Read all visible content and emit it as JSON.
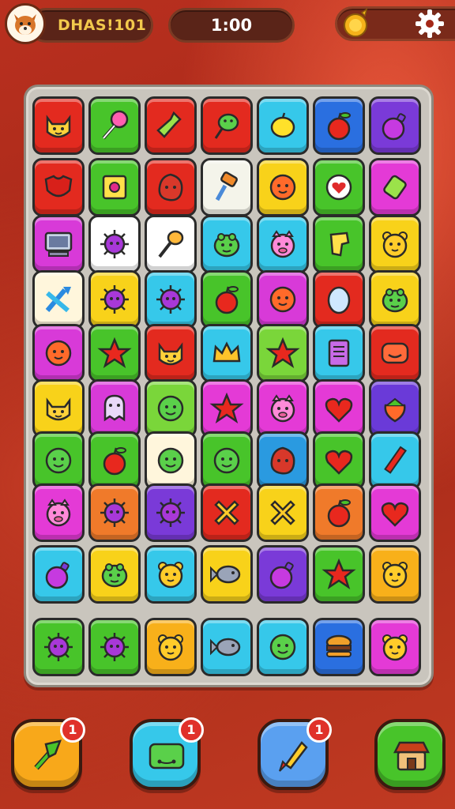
{
  "header": {
    "player_name": "DHAS!101",
    "timer": "1:00",
    "avatar_icon": "fox-avatar-icon",
    "coin_icon": "coin-icon",
    "settings_icon": "gear-icon"
  },
  "board": {
    "columns": 7,
    "rows": 10,
    "tiles": [
      [
        {
          "c": "#e32a1f",
          "i": "cat-face"
        },
        {
          "c": "#48c42a",
          "i": "lollipop"
        },
        {
          "c": "#e32a1f",
          "i": "bottle"
        },
        {
          "c": "#e32a1f",
          "i": "leaf"
        },
        {
          "c": "#36c8ea",
          "i": "lemon"
        },
        {
          "c": "#2a6fe0",
          "i": "apple"
        },
        {
          "c": "#7a3ad8",
          "i": "bomb"
        }
      ],
      [
        {
          "c": "#e32a1f",
          "i": "shirt"
        },
        {
          "c": "#48c42a",
          "i": "safe"
        },
        {
          "c": "#e32a1f",
          "i": "blob"
        },
        {
          "c": "#f4f4ea",
          "i": "hammer"
        },
        {
          "c": "#f8d21a",
          "i": "ball"
        },
        {
          "c": "#48c42a",
          "i": "heart-disc"
        },
        {
          "c": "#e43ad6",
          "i": "candy"
        }
      ],
      [
        {
          "c": "#d83ad8",
          "i": "computer"
        },
        {
          "c": "#ffffff",
          "i": "virus"
        },
        {
          "c": "#ffffff",
          "i": "ladle"
        },
        {
          "c": "#36c8ea",
          "i": "frog"
        },
        {
          "c": "#36c8ea",
          "i": "pig"
        },
        {
          "c": "#48c42a",
          "i": "block"
        },
        {
          "c": "#f8d21a",
          "i": "bear"
        }
      ],
      [
        {
          "c": "#fff6dc",
          "i": "arrows"
        },
        {
          "c": "#f8d21a",
          "i": "virus"
        },
        {
          "c": "#36c8ea",
          "i": "virus"
        },
        {
          "c": "#48c42a",
          "i": "apple"
        },
        {
          "c": "#d83ad8",
          "i": "ball"
        },
        {
          "c": "#e32a1f",
          "i": "egg"
        },
        {
          "c": "#f8d21a",
          "i": "frog"
        }
      ],
      [
        {
          "c": "#d83ad8",
          "i": "ball"
        },
        {
          "c": "#48c42a",
          "i": "star"
        },
        {
          "c": "#e32a1f",
          "i": "cat-face"
        },
        {
          "c": "#36c8ea",
          "i": "crown"
        },
        {
          "c": "#7ad63a",
          "i": "star"
        },
        {
          "c": "#36c8ea",
          "i": "note"
        },
        {
          "c": "#e32a1f",
          "i": "mask"
        }
      ],
      [
        {
          "c": "#f8d21a",
          "i": "cat-face"
        },
        {
          "c": "#d83ad8",
          "i": "ghost"
        },
        {
          "c": "#7ad63a",
          "i": "face"
        },
        {
          "c": "#e43ad6",
          "i": "star"
        },
        {
          "c": "#e43ad6",
          "i": "pig"
        },
        {
          "c": "#e43ad6",
          "i": "heart"
        },
        {
          "c": "#6a3ad8",
          "i": "strawberry"
        }
      ],
      [
        {
          "c": "#48c42a",
          "i": "face"
        },
        {
          "c": "#48c42a",
          "i": "apple"
        },
        {
          "c": "#fff6dc",
          "i": "face"
        },
        {
          "c": "#48c42a",
          "i": "face"
        },
        {
          "c": "#2a9ae0",
          "i": "blob"
        },
        {
          "c": "#48c42a",
          "i": "heart"
        },
        {
          "c": "#36c8ea",
          "i": "pencil"
        }
      ],
      [
        {
          "c": "#e43ad6",
          "i": "pig"
        },
        {
          "c": "#f07a2a",
          "i": "virus"
        },
        {
          "c": "#7a3ad8",
          "i": "virus"
        },
        {
          "c": "#e32a1f",
          "i": "cross"
        },
        {
          "c": "#f8d21a",
          "i": "cross"
        },
        {
          "c": "#f07a2a",
          "i": "apple"
        },
        {
          "c": "#e43ad6",
          "i": "heart"
        }
      ],
      [
        {
          "c": "#36c8ea",
          "i": "bomb"
        },
        {
          "c": "#f8d21a",
          "i": "frog"
        },
        {
          "c": "#36c8ea",
          "i": "bear"
        },
        {
          "c": "#f8d21a",
          "i": "fish"
        },
        {
          "c": "#7a3ad8",
          "i": "bomb"
        },
        {
          "c": "#48c42a",
          "i": "star"
        },
        {
          "c": "#f8b01a",
          "i": "bear"
        }
      ],
      [
        {
          "c": "#48c42a",
          "i": "virus"
        },
        {
          "c": "#48c42a",
          "i": "virus"
        },
        {
          "c": "#f8b01a",
          "i": "bear"
        },
        {
          "c": "#36c8ea",
          "i": "fish"
        },
        {
          "c": "#36c8ea",
          "i": "face"
        },
        {
          "c": "#2a6fe0",
          "i": "burger"
        },
        {
          "c": "#e43ad6",
          "i": "bear"
        }
      ]
    ]
  },
  "powerups": [
    {
      "name": "hammer-powerup-button",
      "color": "#f8a81a",
      "icon": "hammer-icon",
      "badge": "1"
    },
    {
      "name": "card-powerup-button",
      "color": "#36c8ea",
      "icon": "card-icon",
      "badge": "1"
    },
    {
      "name": "rocket-powerup-button",
      "color": "#5aa0f0",
      "icon": "rocket-icon",
      "badge": "1"
    },
    {
      "name": "shop-powerup-button",
      "color": "#48c42a",
      "icon": "shop-icon",
      "badge": ""
    }
  ]
}
